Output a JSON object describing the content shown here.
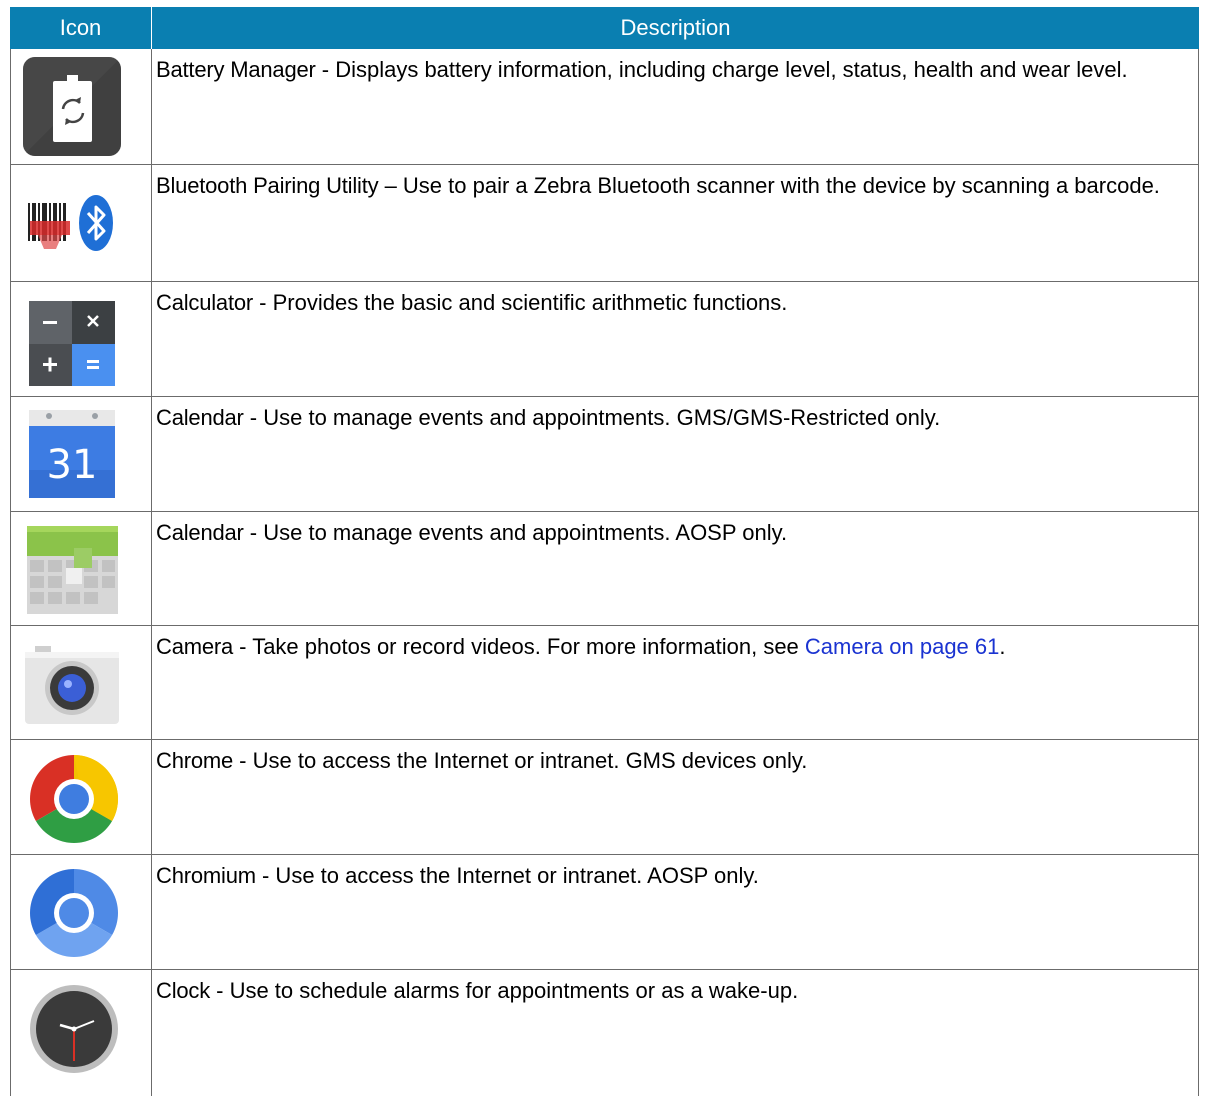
{
  "header": {
    "icon_col": "Icon",
    "desc_col": "Description"
  },
  "rows": [
    {
      "name": "Battery Manager",
      "text": " - Displays battery information, including charge level, status, health and wear level.",
      "icon": "battery-manager-icon"
    },
    {
      "name": "Bluetooth Pairing Utility",
      "text": " – Use to pair a Zebra Bluetooth scanner with the device by scanning a barcode.",
      "icon": "bluetooth-barcode-icon"
    },
    {
      "name": "Calculator",
      "text": " - Provides the basic and scientific arithmetic functions.",
      "icon": "calculator-icon"
    },
    {
      "name": "Calendar",
      "text": " - Use to manage events and appointments. GMS/GMS-Restricted only.",
      "icon": "google-calendar-icon",
      "icon_text": "31"
    },
    {
      "name": "Calendar",
      "text": " - Use to manage events and appointments. AOSP only.",
      "icon": "aosp-calendar-icon"
    },
    {
      "name": "Camera",
      "text": " - Take photos or record videos. For more information, see ",
      "link": "Camera on page 61",
      "after": ".",
      "icon": "camera-icon"
    },
    {
      "name": "Chrome",
      "text": " - Use to access the Internet or intranet. GMS devices only.",
      "icon": "chrome-icon"
    },
    {
      "name": "Chromium",
      "text": " - Use to access the Internet or intranet. AOSP only.",
      "icon": "chromium-icon"
    },
    {
      "name": "Clock",
      "text": " - Use to schedule alarms for appointments or as a wake-up.",
      "icon": "clock-icon"
    }
  ],
  "colors": {
    "header_bg": "#0a7fb1",
    "link": "#1a33d1"
  }
}
